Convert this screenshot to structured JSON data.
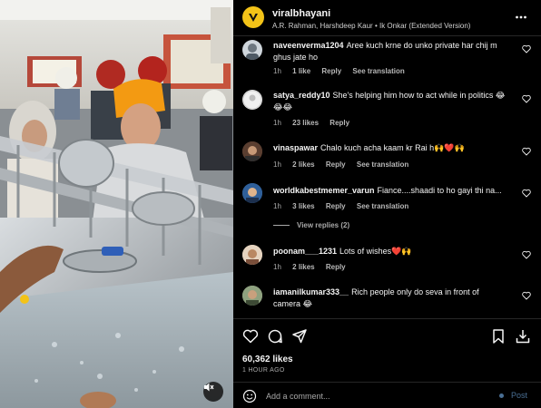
{
  "post": {
    "username": "viralbhayani",
    "audio": "A.R. Rahman, Harshdeep Kaur • Ik Onkar (Extended Version)",
    "more_icon": "more-horizontal-icon"
  },
  "comments": [
    {
      "username": "naveenverma1204",
      "text": "Aree kuch krne do unko private har chij m ghus jate ho",
      "time": "1h",
      "likes": "1 like",
      "reply": "Reply",
      "translate": "See translation"
    },
    {
      "username": "satya_reddy10",
      "text": "She's helping him how to act while in politics 😂😂😂",
      "time": "1h",
      "likes": "23 likes",
      "reply": "Reply",
      "translate": ""
    },
    {
      "username": "vinaspawar",
      "text": "Chalo kuch acha kaam kr Rai h🙌❤️🙌",
      "time": "1h",
      "likes": "2 likes",
      "reply": "Reply",
      "translate": "See translation"
    },
    {
      "username": "worldkabestmemer_varun",
      "text": "Fiance....shaadi to ho gayi thi na...",
      "time": "1h",
      "likes": "3 likes",
      "reply": "Reply",
      "translate": "See translation",
      "view_replies": "View replies (2)"
    },
    {
      "username": "poonam___1231",
      "text": "Lots of wishes❤️🙌",
      "time": "1h",
      "likes": "2 likes",
      "reply": "Reply",
      "translate": ""
    },
    {
      "username": "iamanilkumar333__",
      "text": "Rich people only do seva in front of camera 😂",
      "time": "",
      "likes": "",
      "reply": "",
      "translate": ""
    }
  ],
  "actions": {
    "likes": "60,362 likes",
    "time_ago": "1 HOUR AGO",
    "icons": [
      "heart-icon",
      "comment-icon",
      "share-icon",
      "bookmark-icon",
      "download-icon"
    ]
  },
  "composer": {
    "placeholder": "Add a comment...",
    "post_label": "Post"
  },
  "colors": {
    "background": "#000000",
    "text": "#f5f5f5",
    "muted": "#a8a8a8",
    "post_button": "#4a6f94",
    "brand_badge": "#f3c318",
    "heart_red": "#ed4956"
  }
}
